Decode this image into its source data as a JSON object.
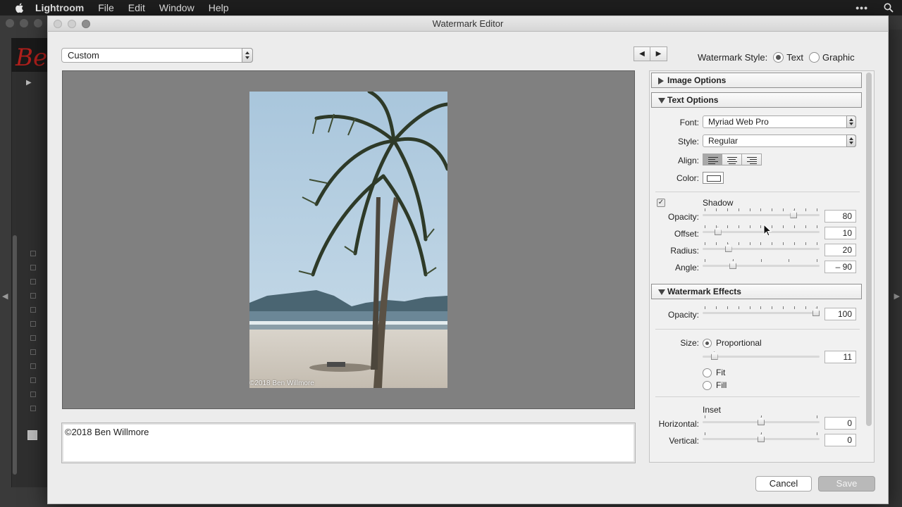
{
  "menubar": {
    "app": "Lightroom",
    "items": [
      "File",
      "Edit",
      "Window",
      "Help"
    ],
    "right_dots": "•••",
    "search_icon": "magnifier"
  },
  "background": {
    "logo_text": "Be"
  },
  "dialog": {
    "title": "Watermark Editor",
    "preset": "Custom",
    "nav_prev": "◀",
    "nav_next": "▶",
    "watermark_style_label": "Watermark Style:",
    "style_text": "Text",
    "style_graphic": "Graphic",
    "style_selected": "Text",
    "preview_watermark": "©2018 Ben Willmore",
    "text_value": "©2018 Ben Willmore",
    "cancel": "Cancel",
    "save": "Save"
  },
  "panel": {
    "image_options": {
      "title": "Image Options",
      "expanded": false
    },
    "text_options": {
      "title": "Text Options",
      "expanded": true,
      "font_label": "Font:",
      "font": "Myriad Web Pro",
      "style_label": "Style:",
      "style": "Regular",
      "align_label": "Align:",
      "align_selected": "left",
      "color_label": "Color:",
      "shadow": {
        "label": "Shadow",
        "enabled": true,
        "opacity_label": "Opacity:",
        "opacity": "80",
        "offset_label": "Offset:",
        "offset": "10",
        "radius_label": "Radius:",
        "radius": "20",
        "angle_label": "Angle:",
        "angle": "– 90"
      }
    },
    "watermark_effects": {
      "title": "Watermark Effects",
      "expanded": true,
      "opacity_label": "Opacity:",
      "opacity": "100",
      "size_label": "Size:",
      "size_proportional": "Proportional",
      "size_value": "11",
      "size_fit": "Fit",
      "size_fill": "Fill",
      "size_selected": "Proportional",
      "inset_label": "Inset",
      "horizontal_label": "Horizontal:",
      "horizontal": "0",
      "vertical_label": "Vertical:",
      "vertical": "0"
    }
  },
  "colors": {
    "dialog_bg": "#ececec",
    "preview_bg": "#808080",
    "save_disabled": "#b9b9b9"
  }
}
